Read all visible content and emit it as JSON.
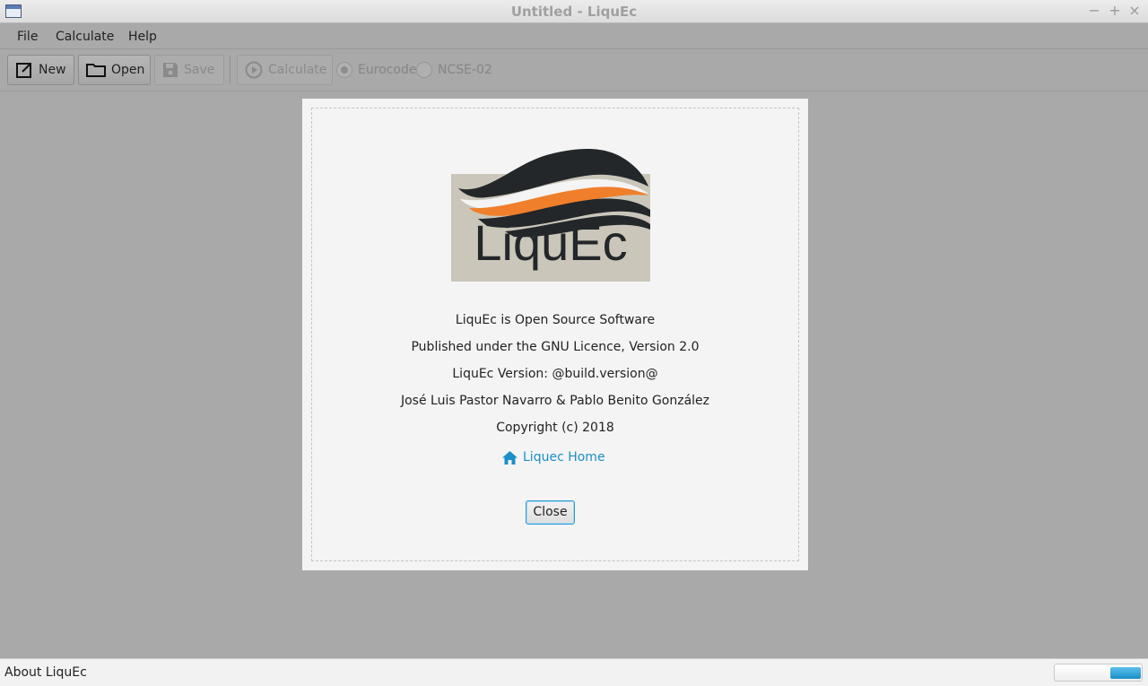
{
  "window": {
    "title": "Untitled - LiquEc"
  },
  "menu": {
    "file": "File",
    "calculate": "Calculate",
    "help": "Help"
  },
  "toolbar": {
    "new_label": "New",
    "open_label": "Open",
    "save_label": "Save",
    "calculate_label": "Calculate",
    "radio_eurocode": "Eurocode",
    "radio_ncse": "NCSE-02",
    "selected_method": "Eurocode"
  },
  "about": {
    "logo_text": "LiquEc",
    "line1": "LiquEc is Open Source Software",
    "line2": "Published under the GNU Licence, Version 2.0",
    "line3": "LiquEc Version: @build.version@",
    "line4": "José Luis Pastor Navarro & Pablo Benito González",
    "line5": "Copyright (c) 2018",
    "home_link": "Liquec Home",
    "close_label": "Close"
  },
  "status": {
    "text": "About LiquEc"
  },
  "colors": {
    "accent": "#1a8fc6",
    "logo_orange": "#f07f2b",
    "logo_dark": "#23272a",
    "logo_bg": "#cac6b9"
  },
  "icons": {
    "new": "new-document-icon",
    "open": "folder-icon",
    "save": "save-icon",
    "calculate": "play-icon",
    "home": "home-icon"
  }
}
